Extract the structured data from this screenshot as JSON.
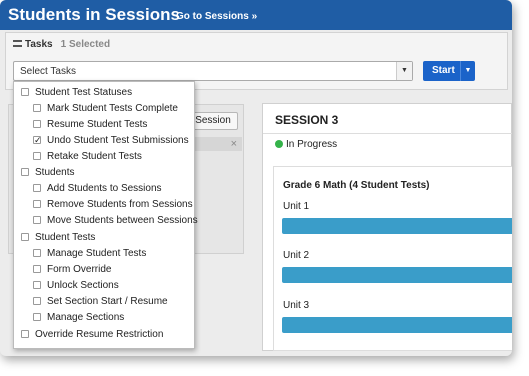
{
  "header": {
    "title": "Students in Sessions",
    "goto_link": "Go to Sessions »"
  },
  "tasks": {
    "label": "Tasks",
    "selected": "1 Selected",
    "select_value": "Select Tasks",
    "start_label": "Start"
  },
  "left": {
    "session_button": "Session",
    "close_symbol": "×"
  },
  "session": {
    "title": "SESSION 3",
    "status": "In Progress",
    "status_color": "#35b34a",
    "test_title": "Grade 6 Math (4 Student Tests)",
    "units": [
      "Unit 1",
      "Unit 2",
      "Unit 3"
    ],
    "bar_color": "#3a9dc9"
  },
  "menu": {
    "groups": [
      {
        "label": "Student Test Statuses",
        "checked": false,
        "items": [
          {
            "label": "Mark Student Tests Complete",
            "checked": false
          },
          {
            "label": "Resume Student Tests",
            "checked": false
          },
          {
            "label": "Undo Student Test Submissions",
            "checked": true
          },
          {
            "label": "Retake Student Tests",
            "checked": false
          }
        ]
      },
      {
        "label": "Students",
        "checked": false,
        "items": [
          {
            "label": "Add Students to Sessions",
            "checked": false
          },
          {
            "label": "Remove Students from Sessions",
            "checked": false
          },
          {
            "label": "Move Students between Sessions",
            "checked": false
          }
        ]
      },
      {
        "label": "Student Tests",
        "checked": false,
        "items": [
          {
            "label": "Manage Student Tests",
            "checked": false
          },
          {
            "label": "Form Override",
            "checked": false
          },
          {
            "label": "Unlock Sections",
            "checked": false
          },
          {
            "label": "Set Section Start / Resume",
            "checked": false
          },
          {
            "label": "Manage Sections",
            "checked": false
          }
        ]
      },
      {
        "label": "Override Resume Restriction",
        "checked": false,
        "items": []
      }
    ]
  },
  "colors": {
    "header_bg": "#1f5da5",
    "start_bg": "#1b63c9"
  }
}
